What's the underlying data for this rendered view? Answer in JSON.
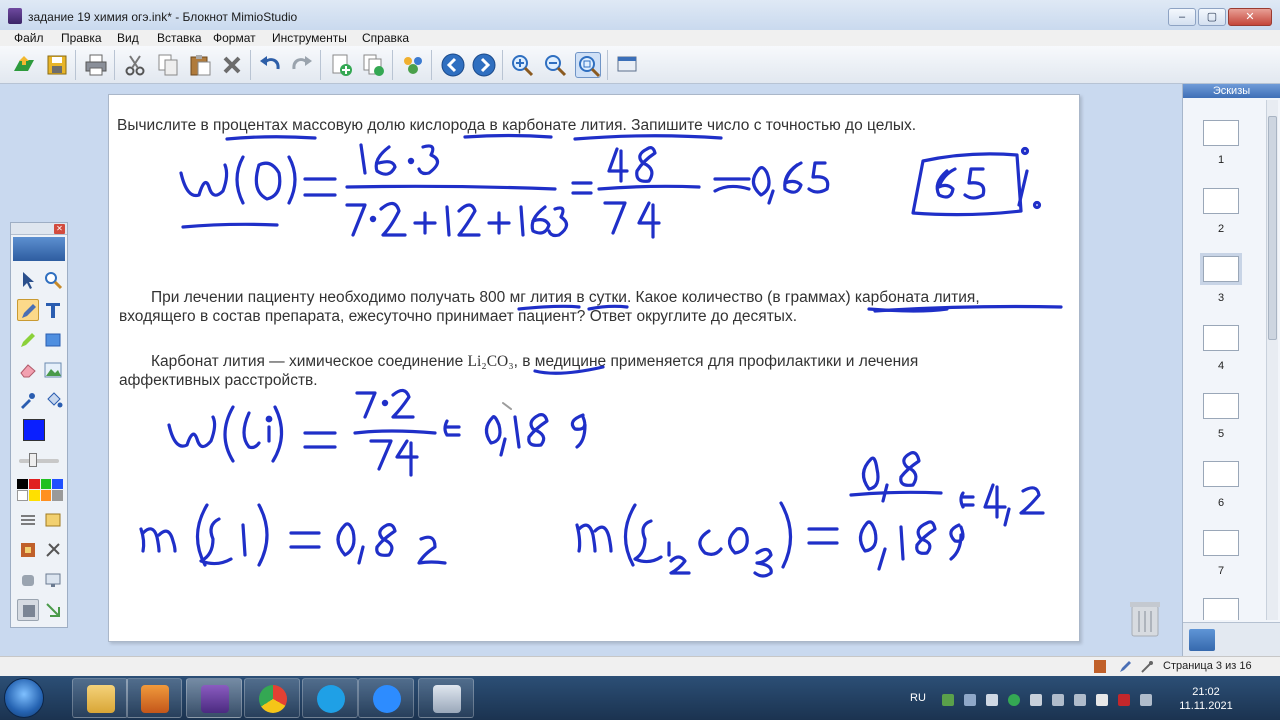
{
  "window": {
    "title": "задание 19 химия огэ.ink* - Блокнот MimioStudio",
    "buttons": [
      "–",
      "▢",
      "✕"
    ]
  },
  "menu": {
    "items": [
      "Файл",
      "Правка",
      "Вид",
      "Вставка",
      "Формат",
      "Инструменты",
      "Справка"
    ]
  },
  "toolbar": {
    "buttons": [
      "open-icon",
      "save-icon",
      "print-icon",
      "cut-icon",
      "copy-icon",
      "paste-icon",
      "delete-icon",
      "undo-icon",
      "redo-icon",
      "new-page-icon",
      "duplicate-page-icon",
      "gallery-icon",
      "back-icon",
      "forward-icon",
      "zoom-in-icon",
      "zoom-out-icon",
      "zoom-fit-icon",
      "screen-icon"
    ]
  },
  "page": {
    "question1": "Вычислите в процентах массовую долю кислорода в карбонате лития. Запишите число с точностью до целых.",
    "question2_line1": "При лечении пациенту необходимо получать 800 мг лития в сутки. Какое количество (в граммах) карбоната лития,",
    "question2_line2": "входящего в состав препарата, ежесуточно принимает пациент? Ответ округлите до десятых.",
    "note_line1_a": "Карбонат лития — химическое соединение ",
    "note_formula": "Li₂CO₃",
    "note_line1_b": ", в медицине применяется для профилактики и лечения",
    "note_line2": "аффективных расстройств.",
    "ink_color": "#1f2fc8"
  },
  "thumbnails": {
    "header": "Эскизы",
    "pages": [
      "1",
      "2",
      "3",
      "4",
      "5",
      "6",
      "7"
    ],
    "selected": "3"
  },
  "status": {
    "page_info": "Страница 3 из 16"
  },
  "taskbar": {
    "apps": [
      "explorer",
      "media-player",
      "mimio-notebook",
      "chrome",
      "skype",
      "zoom",
      "calculator"
    ],
    "language": "RU",
    "time": "21:02",
    "date": "11.11.2021"
  }
}
